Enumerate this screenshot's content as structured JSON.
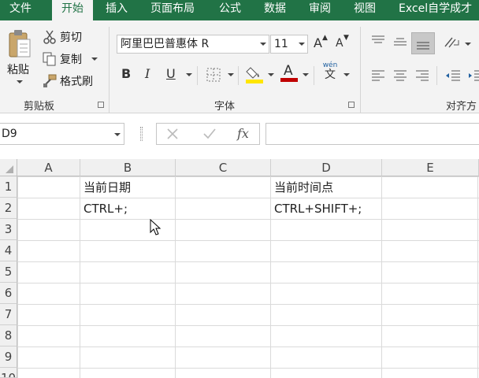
{
  "tabs": [
    "文件",
    "开始",
    "插入",
    "页面布局",
    "公式",
    "数据",
    "审阅",
    "视图",
    "Excel自学成才"
  ],
  "active_tab": "开始",
  "clipboard": {
    "paste_label": "粘贴",
    "cut_label": "剪切",
    "copy_label": "复制",
    "format_painter_label": "格式刷",
    "group_label": "剪贴板"
  },
  "font": {
    "font_name": "阿里巴巴普惠体 R",
    "font_size": "11",
    "bold_label": "B",
    "italic_label": "I",
    "underline_label": "U",
    "font_color_label": "A",
    "grow_label": "A",
    "shrink_label": "A",
    "phonetic_top": "wén",
    "phonetic_bottom": "文",
    "group_label": "字体",
    "highlight_color": "#ffe600",
    "font_color": "#c00000"
  },
  "alignment": {
    "group_label": "对齐方"
  },
  "formula_bar": {
    "name_box": "D9",
    "fx_label": "fx",
    "formula": ""
  },
  "grid": {
    "columns": [
      "A",
      "B",
      "C",
      "D",
      "E"
    ],
    "rows": [
      "1",
      "2",
      "3",
      "4",
      "5",
      "6",
      "7",
      "8",
      "9",
      "10"
    ],
    "cells": {
      "B1": "当前日期",
      "D1": "当前时间点",
      "B2": "CTRL+;",
      "D2": "CTRL+SHIFT+;"
    }
  },
  "colors": {
    "ribbon_green": "#217346",
    "ribbon_bg": "#f3f3f3"
  }
}
